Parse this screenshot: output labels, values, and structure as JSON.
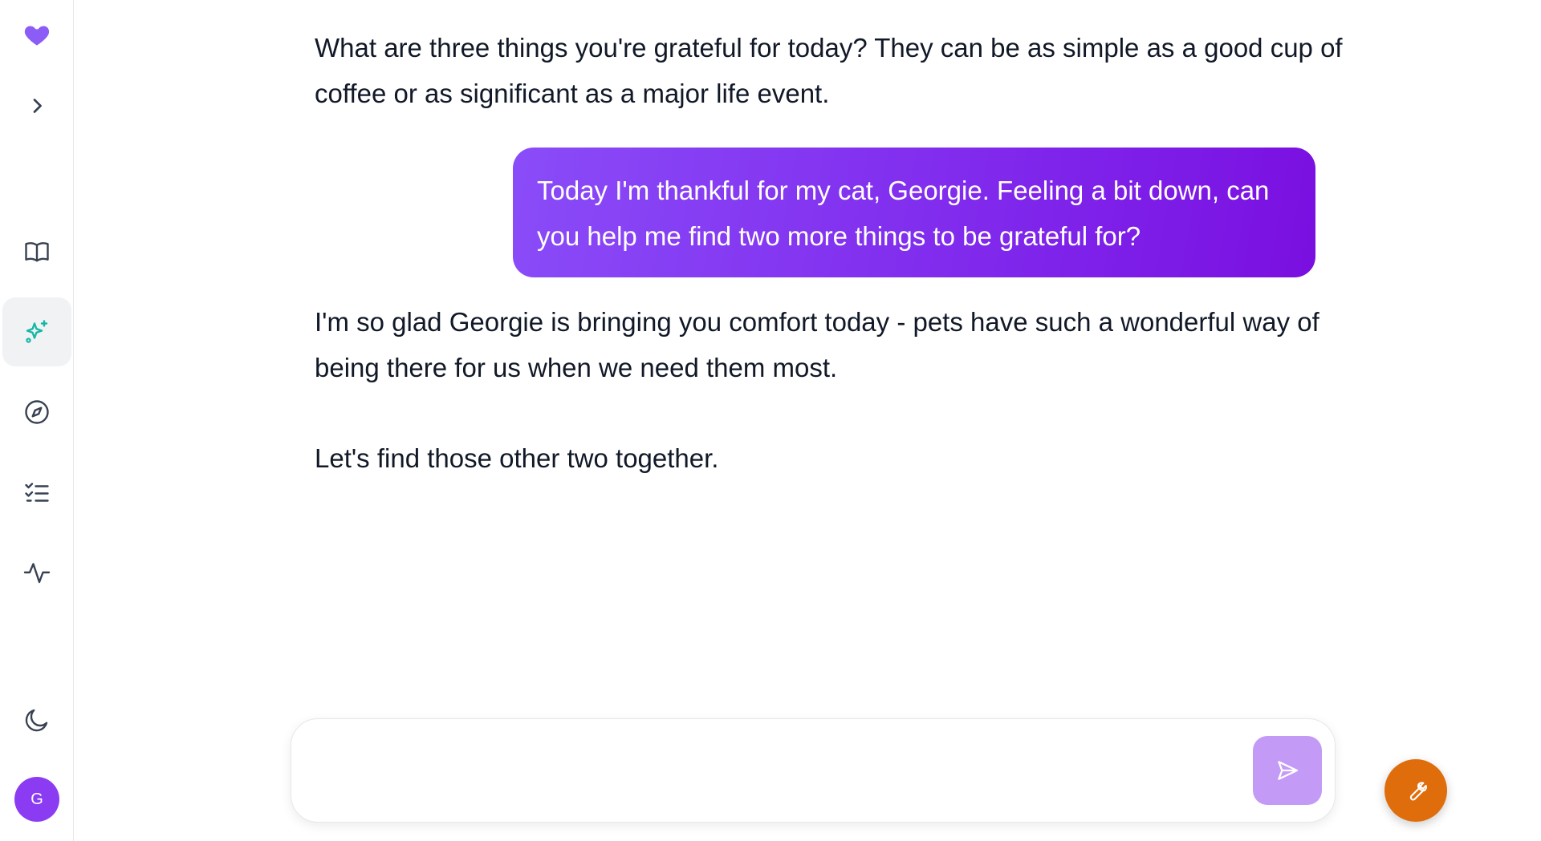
{
  "sidebar": {
    "items": [
      {
        "name": "heart-logo-icon"
      },
      {
        "name": "chevron-right-icon"
      },
      {
        "name": "book-open-icon"
      },
      {
        "name": "sparkles-icon",
        "active": true
      },
      {
        "name": "compass-icon"
      },
      {
        "name": "checklist-icon"
      },
      {
        "name": "activity-icon"
      },
      {
        "name": "moon-icon"
      }
    ],
    "avatar_initial": "G"
  },
  "colors": {
    "brand": "#8b5cf6",
    "active_icon": "#14b8a6",
    "user_bubble": "#7e22ea",
    "send_button": "#c39af6",
    "fab": "#e06d0b"
  },
  "chat": {
    "messages": [
      {
        "role": "assistant",
        "text": "What are three things you're grateful for today? They can be as simple as a good cup of coffee or as significant as a major life event."
      },
      {
        "role": "user",
        "text": "Today I'm thankful for my cat, Georgie. Feeling a bit down, can you help me find two more things to be grateful for?"
      },
      {
        "role": "assistant",
        "text": "I'm so glad Georgie is bringing you comfort today - pets have such a wonderful way of being there for us when we need them most."
      },
      {
        "role": "assistant",
        "text": "Let's find those other two together."
      }
    ]
  },
  "composer": {
    "value": "",
    "placeholder": "",
    "send_icon": "send-icon"
  },
  "fab": {
    "icon": "wrench-icon"
  }
}
